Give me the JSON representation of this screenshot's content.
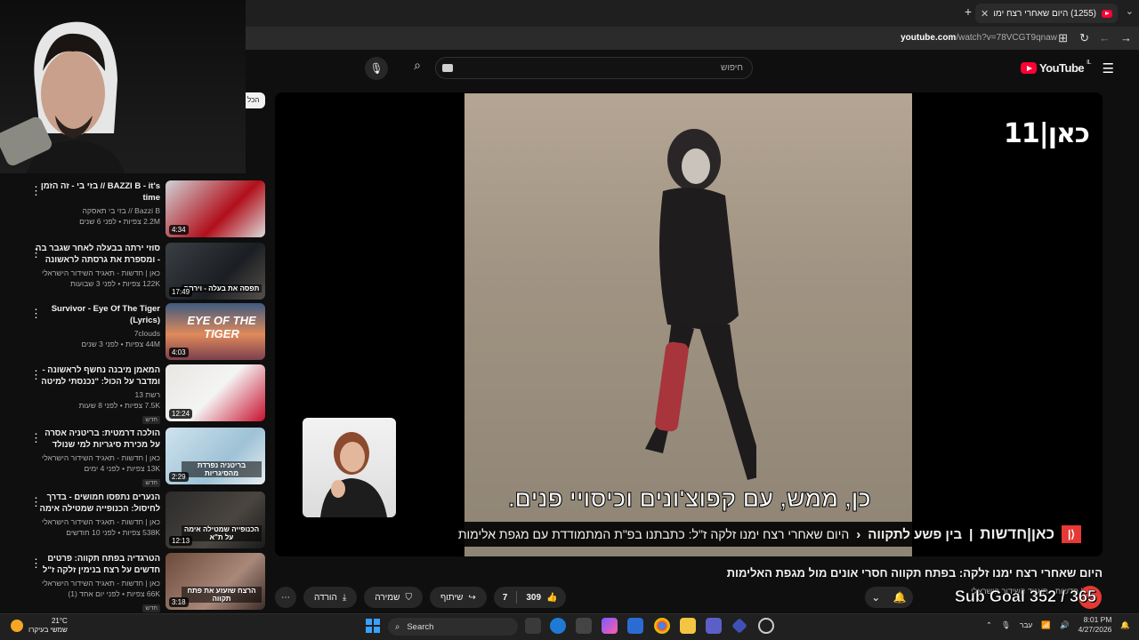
{
  "browser": {
    "tab_title": "(1255) היום שאחרי רצח ימנו",
    "url_domain": "youtube.com",
    "url_path": "/watch?v=78VCGT9qnaw"
  },
  "youtube": {
    "logo_text": "YouTube",
    "logo_sup": "IL",
    "search_placeholder": "חיפוש"
  },
  "player": {
    "channel_logo": "כאן|11",
    "subtitle": "כן, ממש, עם קפוצ'ונים וכיסויי פנים.",
    "lower_third": {
      "badge": "כאן",
      "network": "כאן|חדשות",
      "separator": "|",
      "program": "בין פשע לתקווה",
      "headline": "היום שאחרי רצח ימנו זלקה ז\"ל: כתבתנו בפ\"ת המתמודדת עם מגפת אלימות"
    }
  },
  "video": {
    "title": "היום שאחרי רצח ימנו זלקה: בפתח תקווה חסרי אונים מול מגפת האלימות",
    "channel": "כאן | חדשות - תאגיד השידור הישראלי",
    "actions": {
      "download": "הורדה",
      "save": "שמירה",
      "share": "שיתוף",
      "dislikes": "7",
      "likes": "309"
    }
  },
  "overlay": {
    "sub_goal": "Sub Goal 352 / 365",
    "filter_chip": "הכל"
  },
  "sidebar": {
    "items": [
      {
        "title": "BAZZI B - it's // בזי בי - זה הזמן time",
        "channel": "Bazzi B // בזי בי תאסקה",
        "meta": "2.2M צפיות • לפני 6 שנים",
        "duration": "4:34",
        "caption": "",
        "badge": ""
      },
      {
        "title": "סוזי ירתה בבעלה לאחר שגבר בה - ומספרת את גרסתה לראשונה ממעצ...",
        "channel": "כאן | חדשות - תאגיד השידור הישראלי",
        "meta": "122K צפיות • לפני 3 שבועות",
        "duration": "17:49",
        "caption": "תפסה את בעלה - וירתה",
        "badge": ""
      },
      {
        "title": "Survivor - Eye Of The Tiger (Lyrics)",
        "channel": "7clouds",
        "meta": "44M צפיות • לפני 3 שנים",
        "duration": "4:03",
        "caption": "EYE OF THE TIGER",
        "badge": ""
      },
      {
        "title": "המאמן מיבנה נחשף לראשונה - ומדבר על הכול: \"נכנסתי למיטה ולא ...",
        "channel": "רשת 13",
        "meta": "7.5K צפיות • לפני 8 שעות",
        "duration": "12:24",
        "caption": "",
        "badge": "חדש"
      },
      {
        "title": "הולכה דרמטית: בריטניה אסרה על מכירת סיגריות למי שנולד אחרי 2009",
        "channel": "כאן | חדשות - תאגיד השידור הישראלי",
        "meta": "13K צפיות • לפני 4 ימים",
        "duration": "2:29",
        "caption": "בריטניה נפרדת מהסיגריות",
        "badge": "חדש"
      },
      {
        "title": "הנערים נתפסו חמושים - בדרך לחיסול: הכנופייה שמטילה אימה על ...",
        "channel": "כאן | חדשות - תאגיד השידור הישראלי",
        "meta": "538K צפיות • לפני 10 חודשים",
        "duration": "12:13",
        "caption": "הכנופייה שמטילה אימה על ת\"א",
        "badge": ""
      },
      {
        "title": "הטרגדיה בפתח תקווה: פרטים חדשים על רצח בנימין זלקה ז\"ל",
        "channel": "כאן | חדשות - תאגיד השידור הישראלי",
        "meta": "66K צפיות • לפני יום אחד (1)",
        "duration": "3:18",
        "caption": "הרצח שזעזע את פתח תקווה",
        "badge": "חדש"
      }
    ]
  },
  "taskbar": {
    "weather_temp": "21°C",
    "weather_desc": "שמשי בעיקרו",
    "search_label": "Search",
    "language": "עבר",
    "time": "8:01 PM",
    "date": "4/27/2026"
  },
  "colors": {
    "youtube_red": "#ff0033",
    "kan_red": "#e53935",
    "background": "#0f0f0f"
  }
}
